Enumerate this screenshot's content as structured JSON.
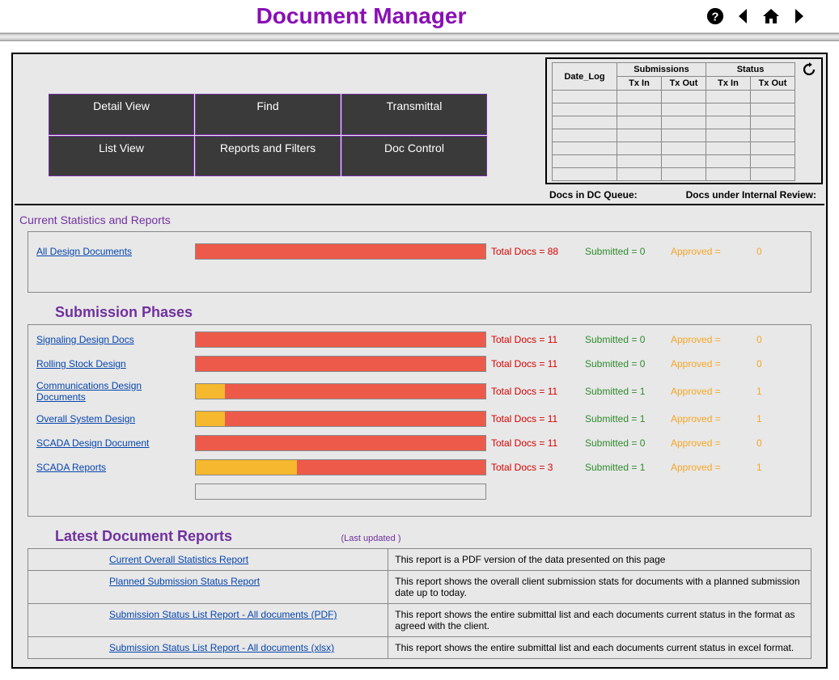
{
  "header": {
    "title": "Document Manager"
  },
  "buttons": {
    "detail": "Detail View",
    "find": "Find",
    "transmittal": "Transmittal",
    "list": "List View",
    "reports": "Reports and Filters",
    "doccontrol": "Doc Control"
  },
  "queue": {
    "cols": {
      "datelog": "Date_Log",
      "submissions": "Submissions",
      "status": "Status",
      "txin": "Tx In",
      "txout": "Tx Out"
    },
    "footer1": "Docs in DC Queue:",
    "footer2": "Docs under Internal Review:"
  },
  "stats": {
    "heading": "Current Statistics and Reports",
    "all_link": "All Design Documents",
    "all": {
      "total": "Total Docs = 88",
      "submitted": "Submitted =  0",
      "approved_lbl": "Approved =",
      "approved_val": "0"
    }
  },
  "phases": {
    "heading": "Submission Phases",
    "rows": [
      {
        "name": "Signaling Design Docs",
        "total": "Total Docs = 11",
        "submitted": "Submitted = 0",
        "approved_lbl": "Approved =",
        "approved_val": "0",
        "orange": 0
      },
      {
        "name": "Rolling Stock Design",
        "total": "Total Docs = 11",
        "submitted": "Submitted = 0",
        "approved_lbl": "Approved =",
        "approved_val": "0",
        "orange": 0
      },
      {
        "name": "Communications Design Documents",
        "total": "Total Docs = 11",
        "submitted": "Submitted = 1",
        "approved_lbl": "Approved =",
        "approved_val": "1",
        "orange": 10
      },
      {
        "name": "Overall System Design",
        "total": "Total Docs = 11",
        "submitted": "Submitted = 1",
        "approved_lbl": "Approved =",
        "approved_val": "1",
        "orange": 10
      },
      {
        "name": "SCADA Design Document",
        "total": "Total Docs = 11",
        "submitted": "Submitted = 0",
        "approved_lbl": "Approved =",
        "approved_val": "0",
        "orange": 0
      },
      {
        "name": "SCADA Reports",
        "total": "Total Docs = 3",
        "submitted": "Submitted = 1",
        "approved_lbl": "Approved =",
        "approved_val": "1",
        "orange": 35
      }
    ]
  },
  "reports": {
    "heading": "Latest Document Reports",
    "last_updated": "(Last updated )",
    "rows": [
      {
        "link": "Current Overall Statistics Report",
        "desc": "This report is a PDF version of the data presented on this page"
      },
      {
        "link": "Planned Submission Status Report",
        "desc": "This report shows the overall client submission stats for documents with a planned submission date up to today."
      },
      {
        "link": "Submission Status List Report - All documents (PDF)",
        "desc": "This report shows the entire submittal list and each documents current status in the format as agreed with the client."
      },
      {
        "link": "Submission Status List Report - All documents (xlsx)",
        "desc": "This report shows the entire submittal list and each documents current status in excel format."
      }
    ]
  },
  "chart_data": {
    "type": "bar",
    "title": "Document submission progress",
    "series": [
      {
        "name": "All Design Documents",
        "total": 88,
        "submitted": 0,
        "approved": 0
      },
      {
        "name": "Signaling Design Docs",
        "total": 11,
        "submitted": 0,
        "approved": 0
      },
      {
        "name": "Rolling Stock Design",
        "total": 11,
        "submitted": 0,
        "approved": 0
      },
      {
        "name": "Communications Design Documents",
        "total": 11,
        "submitted": 1,
        "approved": 1
      },
      {
        "name": "Overall System Design",
        "total": 11,
        "submitted": 1,
        "approved": 1
      },
      {
        "name": "SCADA Design Document",
        "total": 11,
        "submitted": 0,
        "approved": 0
      },
      {
        "name": "SCADA Reports",
        "total": 3,
        "submitted": 1,
        "approved": 1
      }
    ]
  }
}
